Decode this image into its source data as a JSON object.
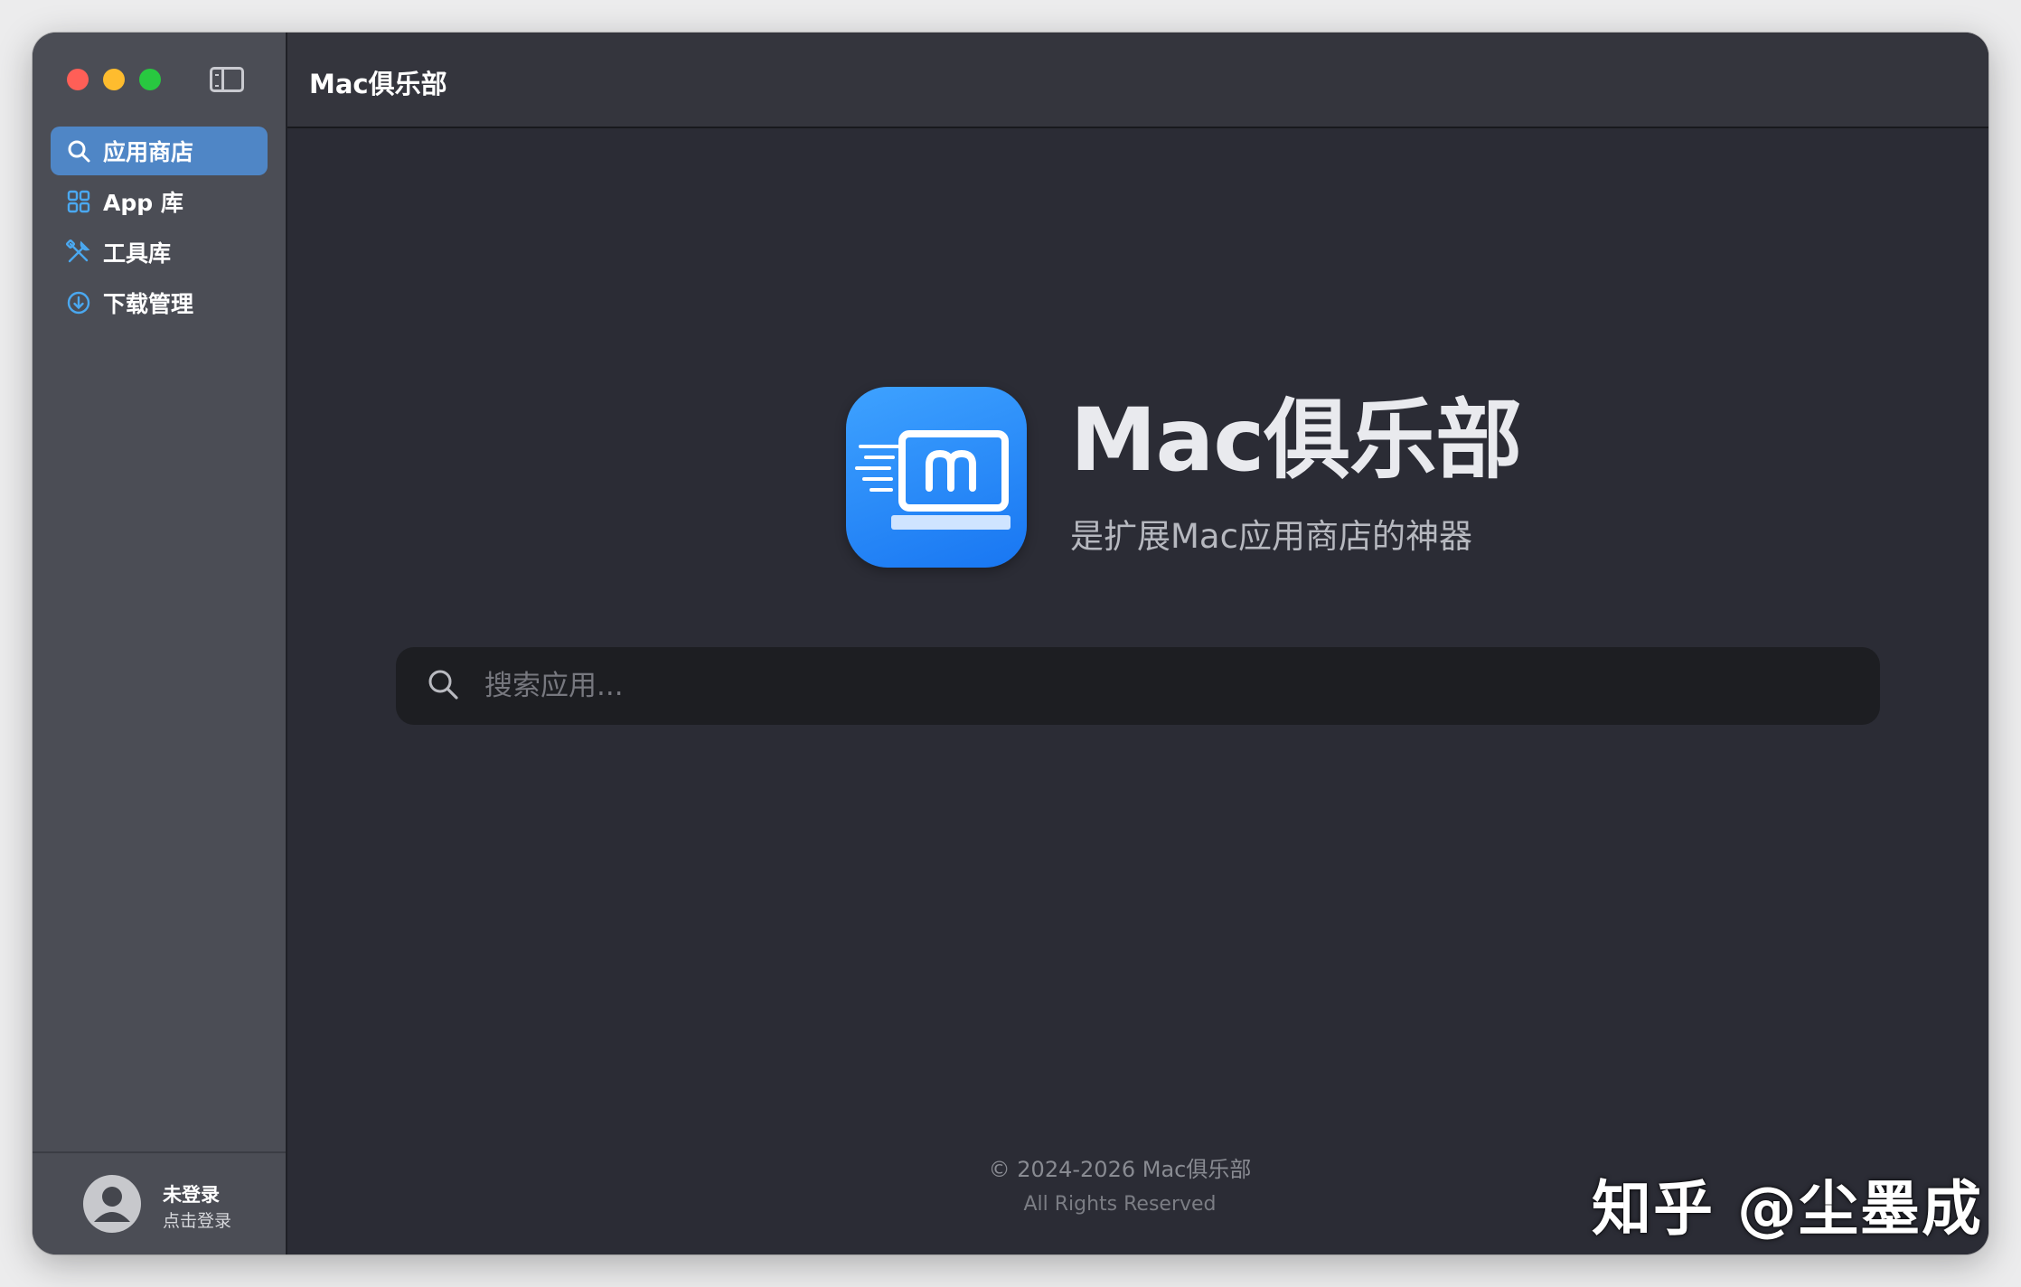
{
  "window": {
    "title": "Mac俱乐部"
  },
  "sidebar": {
    "items": [
      {
        "label": "应用商店",
        "icon": "search-icon",
        "active": true
      },
      {
        "label": "App 库",
        "icon": "grid-icon",
        "active": false
      },
      {
        "label": "工具库",
        "icon": "tools-icon",
        "active": false
      },
      {
        "label": "下载管理",
        "icon": "download-icon",
        "active": false
      }
    ],
    "user": {
      "name": "未登录",
      "action": "点击登录"
    }
  },
  "hero": {
    "title": "Mac俱乐部",
    "subtitle": "是扩展Mac应用商店的神器"
  },
  "search": {
    "placeholder": "搜索应用..."
  },
  "footer": {
    "copyright": "© 2024-2026 Mac俱乐部",
    "rights": "All Rights Reserved"
  },
  "watermark": "知乎 @尘墨成",
  "colors": {
    "accent": "#4f86c6",
    "icon_blue": "#1876f2",
    "sidebar_bg": "#4b4d55",
    "main_bg": "#2b2c35"
  }
}
